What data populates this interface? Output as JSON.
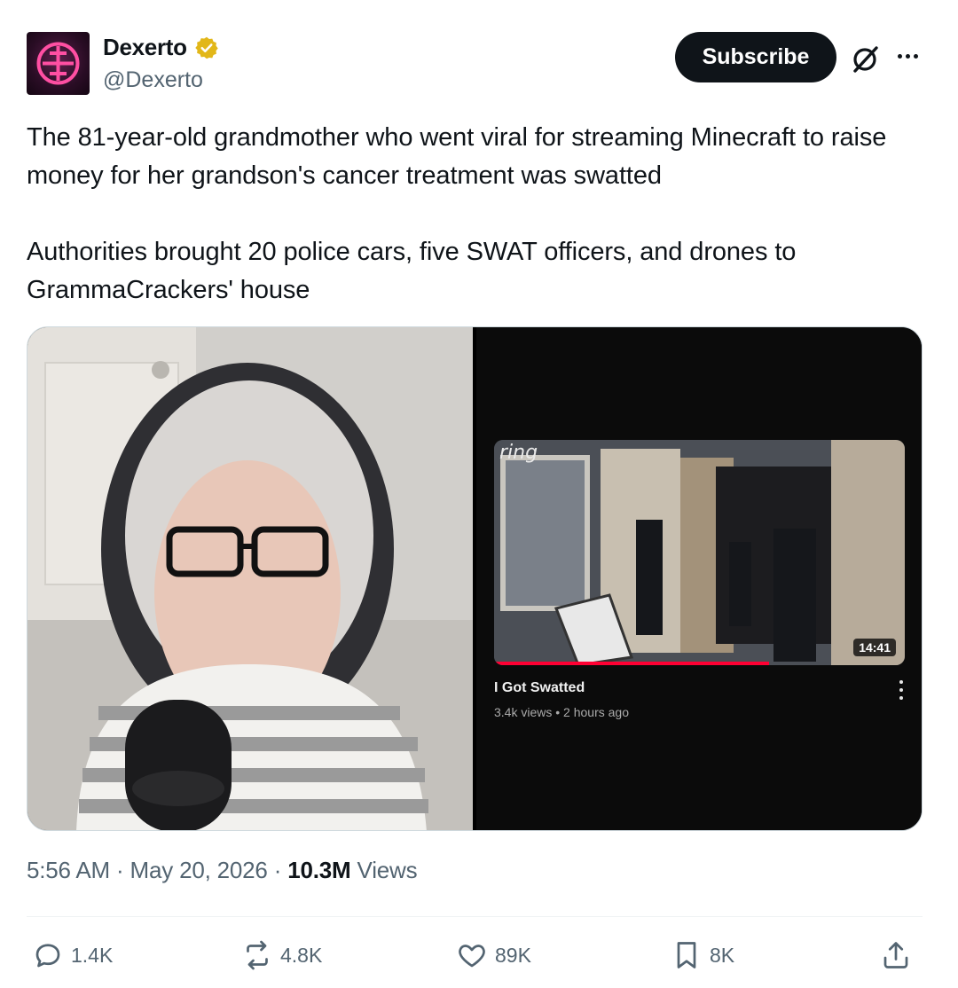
{
  "author": {
    "display_name": "Dexerto",
    "handle": "@Dexerto",
    "verified_icon": "verified-badge-icon",
    "avatar_icon": "dexerto-logo-icon"
  },
  "header": {
    "subscribe_label": "Subscribe",
    "grok_icon": "grok-icon",
    "more_icon": "more-icon"
  },
  "tweet": {
    "paragraph_1": "The 81-year-old grandmother who went viral for streaming Minecraft to raise money for her grandson's cancer treatment was swatted",
    "paragraph_2": "Authorities brought 20 police cars, five SWAT officers, and drones to GrammaCrackers' house"
  },
  "media": {
    "left_image": "woman-streaming-photo",
    "video": {
      "watermark": "ring",
      "duration": "14:41",
      "title": "I Got Swatted",
      "meta": "3.4k views • 2 hours ago",
      "menu_icon": "vertical-dots-icon"
    }
  },
  "meta": {
    "time": "5:56 AM",
    "separator": "·",
    "date": "May 20, 2026",
    "views_count": "10.3M",
    "views_label": "Views"
  },
  "actions": {
    "replies": "1.4K",
    "reposts": "4.8K",
    "likes": "89K",
    "bookmarks": "8K"
  },
  "colors": {
    "text_primary": "#0f1419",
    "text_secondary": "#536471",
    "verified_gold": "#e2b719",
    "progress_red": "#ff0033"
  }
}
